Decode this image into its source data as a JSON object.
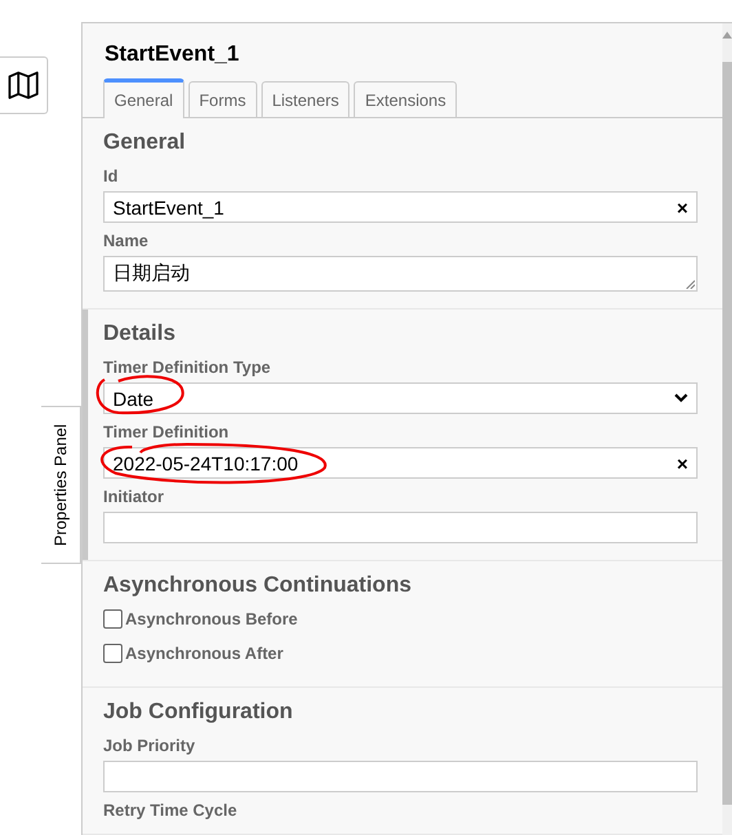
{
  "header": {
    "title": "StartEvent_1"
  },
  "tabs": [
    {
      "label": "General",
      "selected": true
    },
    {
      "label": "Forms",
      "selected": false
    },
    {
      "label": "Listeners",
      "selected": false
    },
    {
      "label": "Extensions",
      "selected": false
    }
  ],
  "side_tab": {
    "label": "Properties Panel"
  },
  "sections": [
    {
      "title": "General",
      "highlighted": false,
      "fields": [
        {
          "kind": "text",
          "label": "Id",
          "value": "StartEvent_1",
          "clear": "×"
        },
        {
          "kind": "textarea",
          "label": "Name",
          "value": "日期启动"
        }
      ]
    },
    {
      "title": "Details",
      "highlighted": true,
      "fields": [
        {
          "kind": "select",
          "label": "Timer Definition Type",
          "value": "Date"
        },
        {
          "kind": "text",
          "label": "Timer Definition",
          "value": "2022-05-24T10:17:00",
          "clear": "×"
        },
        {
          "kind": "text",
          "label": "Initiator"
        }
      ]
    },
    {
      "title": "Asynchronous Continuations",
      "highlighted": false,
      "fields": [
        {
          "kind": "checkbox",
          "label": "Asynchronous Before",
          "checked": false
        },
        {
          "kind": "checkbox",
          "label": "Asynchronous After",
          "checked": false
        }
      ]
    },
    {
      "title": "Job Configuration",
      "highlighted": false,
      "fields": [
        {
          "kind": "text",
          "label": "Job Priority"
        },
        {
          "kind": "label",
          "label": "Retry Time Cycle"
        }
      ]
    }
  ]
}
